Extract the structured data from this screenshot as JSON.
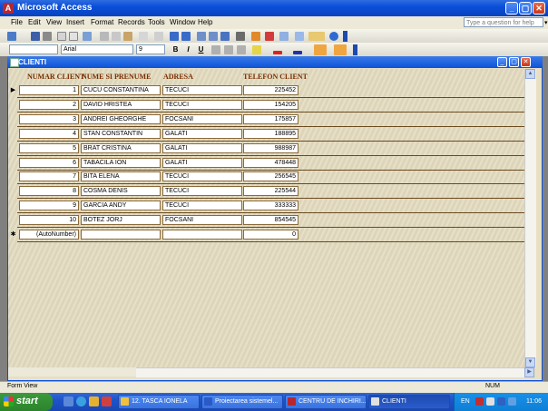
{
  "window": {
    "title": "Microsoft Access",
    "icon_letter": "A"
  },
  "menubar": {
    "items": [
      "File",
      "Edit",
      "View",
      "Insert",
      "Format",
      "Records",
      "Tools",
      "Window",
      "Help"
    ],
    "help_placeholder": "Type a question for help"
  },
  "formatting_toolbar": {
    "font": "Arial",
    "font_size": "9",
    "bold": "B",
    "italic": "I",
    "underline": "U"
  },
  "form": {
    "title": "CLIENTI",
    "headers": [
      "NUMAR CLIENT",
      "NUME SI PRENUME",
      "ADRESA",
      "TELEFON CLIENT"
    ],
    "rows": [
      {
        "id": "1",
        "name": "CUCU CONSTANTINA",
        "address": "TECUCI",
        "phone": "225452"
      },
      {
        "id": "2",
        "name": "DAVID HRISTEA",
        "address": "TECUCI",
        "phone": "154205"
      },
      {
        "id": "3",
        "name": "ANDREI GHEORGHE",
        "address": "FOCSANI",
        "phone": "175857"
      },
      {
        "id": "4",
        "name": "STAN CONSTANTIN",
        "address": "GALATI",
        "phone": "188895"
      },
      {
        "id": "5",
        "name": "BRAT CRISTINA",
        "address": "GALATI",
        "phone": "988987"
      },
      {
        "id": "6",
        "name": "TABACILA ION",
        "address": "GALATI",
        "phone": "478448"
      },
      {
        "id": "7",
        "name": "BITA ELENA",
        "address": "TECUCI",
        "phone": "256545"
      },
      {
        "id": "8",
        "name": "COSMA DENIS",
        "address": "TECUCI",
        "phone": "225544"
      },
      {
        "id": "9",
        "name": "GARCIA ANDY",
        "address": "TECUCI",
        "phone": "333333"
      },
      {
        "id": "10",
        "name": "BOTEZ JORJ",
        "address": "FOCSANI",
        "phone": "854545"
      }
    ],
    "new_row": {
      "id": "(AutoNumber)",
      "name": "",
      "address": "",
      "phone": "0"
    }
  },
  "statusbar": {
    "view": "Form View",
    "num": "NUM"
  },
  "taskbar": {
    "start": "start",
    "tasks": [
      "12. TASCA IONELA",
      "Proiectarea sistemel...",
      "CENTRU DE INCHIRI...",
      "CLIENTI"
    ],
    "language": "EN",
    "clock": "11:06"
  },
  "colors": {
    "title_blue": "#0a4fd8",
    "form_bg": "#e4dcc0",
    "header_text": "#7a2e00",
    "start_green": "#3c9a3c"
  }
}
